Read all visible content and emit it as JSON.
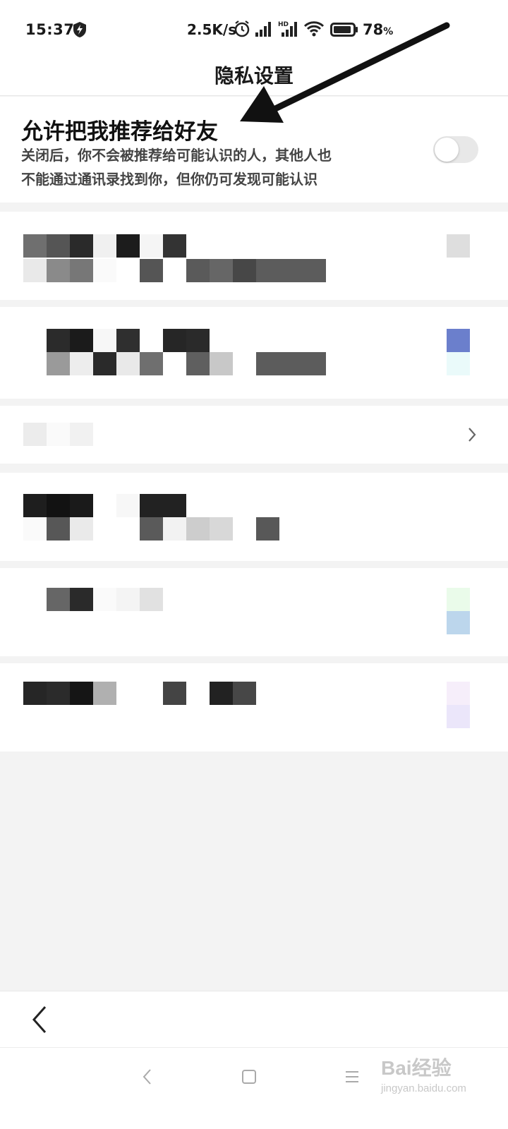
{
  "status_bar": {
    "time": "15:37",
    "speed": "2.5K/s",
    "battery_percent": "78",
    "battery_unit": "%",
    "icons": [
      "shield-bolt-icon",
      "alarm-icon",
      "signal-icon",
      "hd-signal-icon",
      "wifi-icon",
      "battery-icon"
    ]
  },
  "header": {
    "title": "隐私设置"
  },
  "recommend_setting": {
    "title": "允许把我推荐给好友",
    "description_line1": "关闭后，你不会被推荐给可能认识的人，其他人也",
    "description_line2": "不能通过通讯录找到你，但你仍可发现可能认识",
    "enabled": false
  },
  "obscured_rows": [
    {
      "has_toggle": true
    },
    {
      "has_toggle": true
    },
    {
      "has_chevron": true
    },
    {
      "has_toggle": false
    },
    {
      "has_toggle": true
    },
    {
      "has_toggle": true
    }
  ],
  "navigation": {
    "back_icon": "chevron-left-icon",
    "system_buttons": [
      "back-icon",
      "home-icon",
      "menu-icon"
    ]
  },
  "watermark": {
    "text": "Bai经验",
    "url_text": "jingyan.baidu.com"
  },
  "annotation": {
    "arrow_color": "#111111"
  }
}
